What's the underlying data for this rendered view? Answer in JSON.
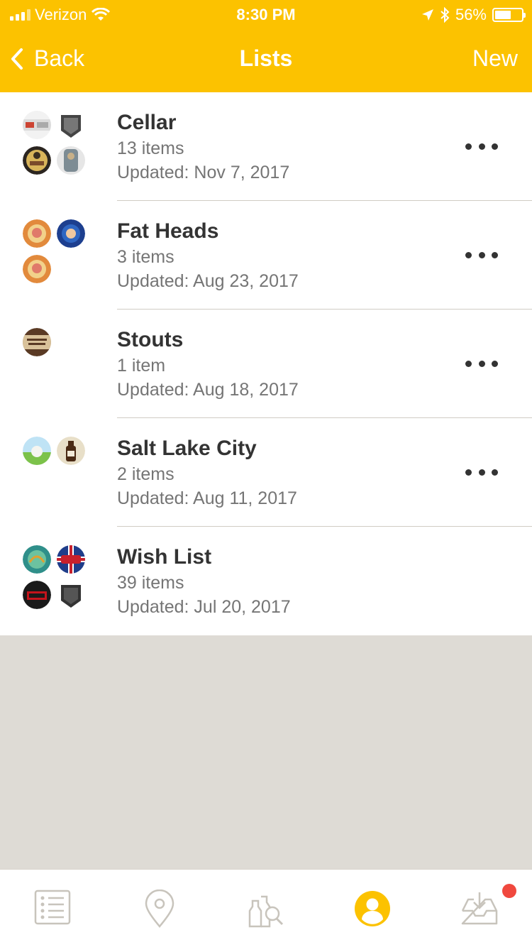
{
  "status_bar": {
    "carrier": "Verizon",
    "time": "8:30 PM",
    "battery": "56%",
    "battery_level": 0.56
  },
  "nav": {
    "back_label": "Back",
    "title": "Lists",
    "new_label": "New"
  },
  "lists": [
    {
      "name": "Cellar",
      "count": "13 items",
      "updated": "Updated: Nov 7, 2017"
    },
    {
      "name": "Fat Heads",
      "count": "3 items",
      "updated": "Updated: Aug 23, 2017"
    },
    {
      "name": "Stouts",
      "count": "1 item",
      "updated": "Updated: Aug 18, 2017"
    },
    {
      "name": "Salt Lake City",
      "count": "2 items",
      "updated": "Updated: Aug 11, 2017"
    },
    {
      "name": "Wish List",
      "count": "39 items",
      "updated": "Updated: Jul 20, 2017"
    }
  ],
  "tabbar": {
    "tabs": [
      {
        "icon": "list-icon"
      },
      {
        "icon": "map-pin-icon"
      },
      {
        "icon": "beer-search-icon"
      },
      {
        "icon": "profile-icon",
        "active": true
      },
      {
        "icon": "inbox-download-icon",
        "badge": true
      }
    ]
  },
  "colors": {
    "accent": "#fcc200",
    "badge": "#f0483e",
    "background": "#dedbd5"
  }
}
